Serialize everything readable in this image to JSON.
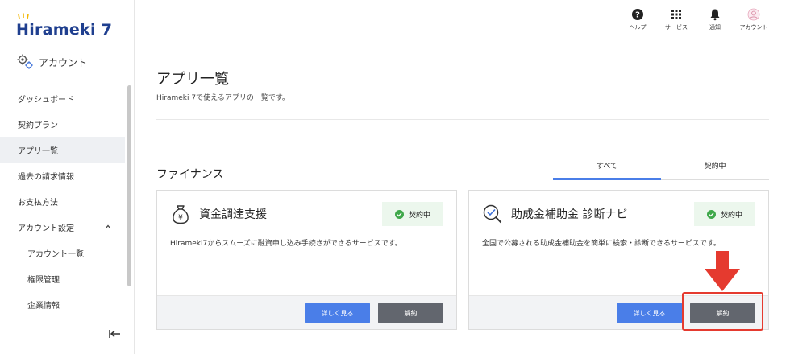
{
  "app": {
    "logo_text": "Hirameki 7",
    "brand_color": "#1f3f8f",
    "accent_color": "#4a7ee8"
  },
  "sidebar": {
    "account_label": "アカウント",
    "items": [
      {
        "label": "ダッシュボード",
        "active": false
      },
      {
        "label": "契約プラン",
        "active": false
      },
      {
        "label": "アプリ一覧",
        "active": true
      },
      {
        "label": "過去の請求情報",
        "active": false
      },
      {
        "label": "お支払方法",
        "active": false
      },
      {
        "label": "アカウント設定",
        "active": false
      },
      {
        "label": "アカウント一覧",
        "active": false
      },
      {
        "label": "権限管理",
        "active": false
      },
      {
        "label": "企業情報",
        "active": false
      }
    ]
  },
  "header": {
    "icons": [
      {
        "label": "ヘルプ",
        "icon": "help-icon"
      },
      {
        "label": "サービス",
        "icon": "grid-icon"
      },
      {
        "label": "通知",
        "icon": "bell-icon"
      },
      {
        "label": "アカウント",
        "icon": "avatar-icon"
      }
    ]
  },
  "main": {
    "title": "アプリ一覧",
    "subtitle": "Hirameki 7で使えるアプリの一覧です。",
    "section_title": "ファイナンス",
    "tabs": [
      {
        "label": "すべて",
        "active": true
      },
      {
        "label": "契約中",
        "active": false
      }
    ],
    "cards": [
      {
        "title": "資金調達支援",
        "icon": "money-bag-icon",
        "badge": "契約中",
        "description": "Hirameki7からスムーズに融資申し込み手続きができるサービスです。",
        "detail_label": "詳しく見る",
        "cancel_label": "解約"
      },
      {
        "title": "助成金補助金 診断ナビ",
        "icon": "magnifier-check-icon",
        "badge": "契約中",
        "description": "全国で公募される助成金補助金を簡単に検索・診断できるサービスです。",
        "detail_label": "詳しく見る",
        "cancel_label": "解約"
      }
    ]
  }
}
